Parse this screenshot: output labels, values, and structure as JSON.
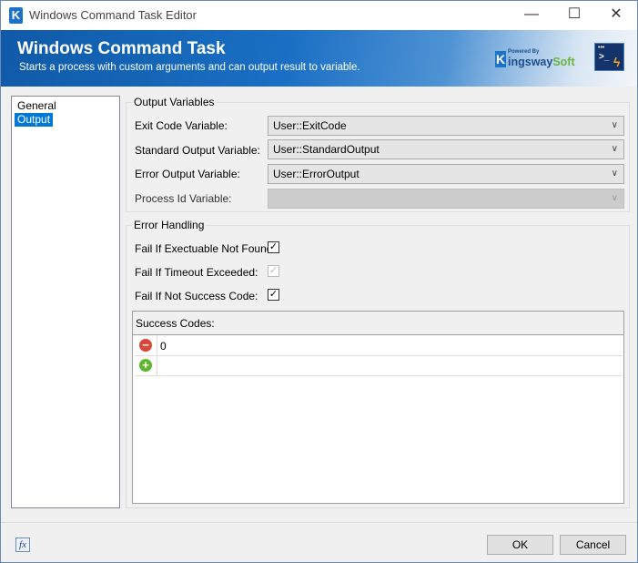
{
  "window": {
    "title": "Windows Command Task Editor",
    "minimize": "—",
    "maximize": "☐",
    "close": "✕",
    "app_icon": "K"
  },
  "banner": {
    "title": "Windows Command Task",
    "subtitle": "Starts a process with custom arguments and can output result to variable.",
    "logo": {
      "powered_by": "Powered By",
      "brand_k": "K",
      "brand_main": "ingsway",
      "brand_accent": "Soft"
    },
    "task_icon": "terminal-lightning-icon"
  },
  "sidebar": {
    "items": [
      {
        "label": "General",
        "selected": false
      },
      {
        "label": "Output",
        "selected": true
      }
    ]
  },
  "output_variables": {
    "legend": "Output Variables",
    "fields": [
      {
        "label": "Exit Code Variable:",
        "value": "User::ExitCode",
        "enabled": true
      },
      {
        "label": "Standard Output Variable:",
        "value": "User::StandardOutput",
        "enabled": true
      },
      {
        "label": "Error Output Variable:",
        "value": "User::ErrorOutput",
        "enabled": true
      },
      {
        "label": "Process Id Variable:",
        "value": "",
        "enabled": false
      }
    ]
  },
  "error_handling": {
    "legend": "Error Handling",
    "checks": [
      {
        "label": "Fail If Exectuable Not Found:",
        "checked": true,
        "enabled": true
      },
      {
        "label": "Fail If Timeout Exceeded:",
        "checked": true,
        "enabled": false
      },
      {
        "label": "Fail If Not Success Code:",
        "checked": true,
        "enabled": true
      }
    ],
    "success_codes": {
      "header": "Success Codes:",
      "rows": [
        {
          "action": "remove",
          "value": "0"
        },
        {
          "action": "add",
          "value": ""
        }
      ]
    }
  },
  "footer": {
    "fx_label": "fx",
    "ok": "OK",
    "cancel": "Cancel"
  }
}
